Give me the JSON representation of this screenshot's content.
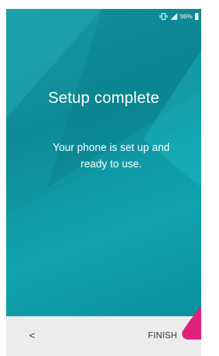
{
  "status_bar": {
    "battery_text": "96%",
    "icons": [
      "vibrate-icon",
      "signal-icon",
      "battery-icon"
    ]
  },
  "setup": {
    "title": "Setup complete",
    "message": "Your phone is set up and ready to use."
  },
  "navigation": {
    "back_label": "<",
    "finish_label": "FINISH",
    "next_chevron": ">"
  },
  "colors": {
    "background_teal": "#0d8a96",
    "text": "#ffffff",
    "nav_bar": "#ececec",
    "pointer": "#e0217a"
  }
}
